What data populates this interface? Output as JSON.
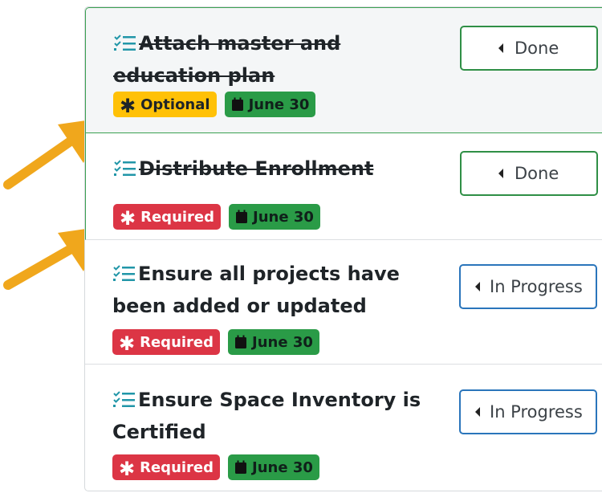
{
  "tasks": [
    {
      "title": "Attach master and education plan",
      "done": true,
      "priority": "Optional",
      "date": "June 30",
      "status_label": "Done"
    },
    {
      "title": "Distribute Enrollment",
      "done": true,
      "priority": "Required",
      "date": "June 30",
      "status_label": "Done"
    },
    {
      "title": "Ensure all projects have been added or updated",
      "done": false,
      "priority": "Required",
      "date": "June 30",
      "status_label": "In Progress"
    },
    {
      "title": "Ensure Space Inventory is Certified",
      "done": false,
      "priority": "Required",
      "date": "June 30",
      "status_label": "In Progress"
    }
  ],
  "colors": {
    "optional": "#ffc107",
    "required": "#dc3545",
    "date": "#2a9b47",
    "done_border": "#2f8f46",
    "progress_border": "#2a75bb",
    "arrow": "#f0a71c",
    "task_icon": "#2196a8"
  },
  "icons": {
    "task": "task-list-icon",
    "priority": "asterisk-icon",
    "date": "calendar-icon",
    "status": "caret-left-icon"
  }
}
